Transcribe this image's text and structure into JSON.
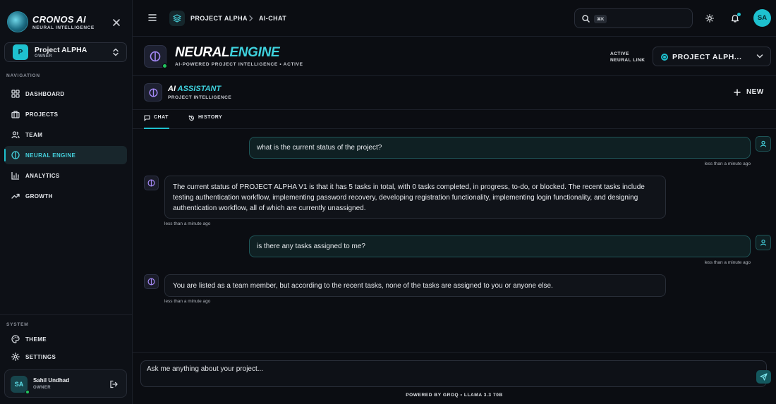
{
  "brand": {
    "name": "CRONOS AI",
    "subtitle": "NEURAL INTELLIGENCE"
  },
  "project_switcher": {
    "avatar": "P",
    "name": "Project ALPHA",
    "role": "OWNER"
  },
  "sidebar": {
    "navigation_label": "NAVIGATION",
    "items": [
      {
        "label": "DASHBOARD",
        "icon": "grid-icon"
      },
      {
        "label": "PROJECTS",
        "icon": "briefcase-icon"
      },
      {
        "label": "TEAM",
        "icon": "users-icon"
      },
      {
        "label": "NEURAL ENGINE",
        "icon": "brain-icon",
        "active": true
      },
      {
        "label": "ANALYTICS",
        "icon": "bar-chart-icon"
      },
      {
        "label": "GROWTH",
        "icon": "trending-up-icon"
      }
    ],
    "system_label": "SYSTEM",
    "system_items": [
      {
        "label": "THEME",
        "icon": "palette-icon"
      },
      {
        "label": "SETTINGS",
        "icon": "gear-icon"
      }
    ],
    "user": {
      "initials": "SA",
      "name": "Sahil Undhad",
      "role": "OWNER"
    }
  },
  "topbar": {
    "breadcrumb": [
      "PROJECT ALPHA",
      "AI-CHAT"
    ],
    "search_shortcut": "⌘K",
    "avatar": "SA"
  },
  "engine": {
    "title_main": "NEURAL",
    "title_accent": "ENGINE",
    "subtitle": "AI-POWERED PROJECT INTELLIGENCE • ACTIVE",
    "link_label_1": "ACTIVE",
    "link_label_2": "NEURAL LINK",
    "selected_project": "PROJECT ALPH..."
  },
  "assistant": {
    "title_main": "AI",
    "title_accent": "ASSISTANT",
    "subtitle": "PROJECT INTELLIGENCE",
    "new_label": "NEW"
  },
  "tabs": [
    {
      "label": "CHAT",
      "icon": "chat-icon",
      "active": true
    },
    {
      "label": "HISTORY",
      "icon": "history-icon"
    }
  ],
  "messages": [
    {
      "role": "user",
      "text": "what is the current status of the project?",
      "time": "less than a minute ago"
    },
    {
      "role": "assistant",
      "text": "The current status of PROJECT ALPHA V1 is that it has 5 tasks in total, with 0 tasks completed, in progress, to-do, or blocked. The recent tasks include testing authentication workflow, implementing password recovery, developing registration functionality, implementing login functionality, and designing authentication workflow, all of which are currently unassigned.",
      "time": "less than a minute ago"
    },
    {
      "role": "user",
      "text": "is there any tasks assigned to me?",
      "time": "less than a minute ago"
    },
    {
      "role": "assistant",
      "text": "You are listed as a team member, but according to the recent tasks, none of the tasks are assigned to you or anyone else.",
      "time": "less than a minute ago"
    }
  ],
  "composer": {
    "placeholder": "Ask me anything about your project...",
    "powered_by": "POWERED BY GROQ • LLAMA 3.3 70B"
  },
  "colors": {
    "accent": "#1ec1cf",
    "background": "#0b0d12",
    "assistant_icon": "#a78bfa",
    "online": "#22c55e"
  }
}
